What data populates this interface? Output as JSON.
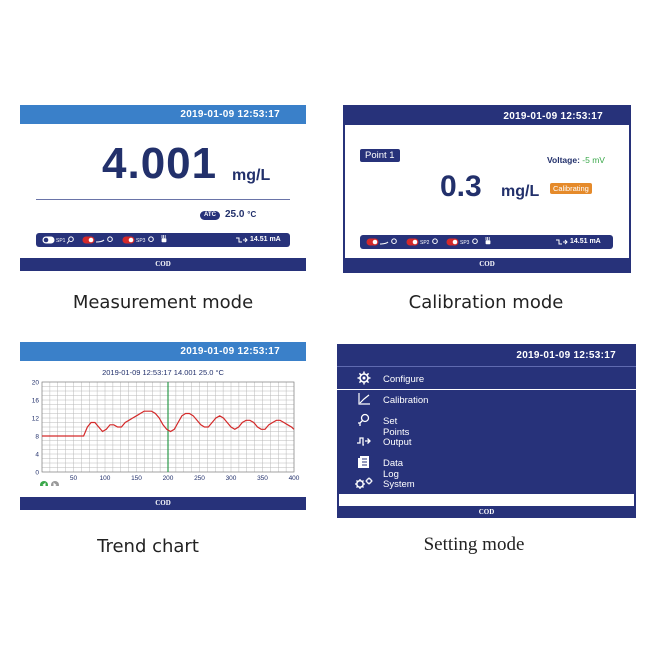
{
  "measurement": {
    "datetime": "2019-01-09   12:53:17",
    "value": "4.001",
    "unit": "mg/L",
    "atc_badge": "ATC",
    "temperature": "25.0",
    "temp_unit": "°C",
    "current": "14.51 mA",
    "relay_labels": [
      "SP1",
      "SP2",
      "SP3"
    ],
    "footer": "COD",
    "caption": "Measurement mode"
  },
  "calibration": {
    "datetime": "2019-01-09   12:53:17",
    "point_label": "Point 1",
    "voltage_label": "Voltage:",
    "voltage_value": "-5 mV",
    "value": "0.3",
    "unit": "mg/L",
    "status": "Calibrating",
    "current": "14.51 mA",
    "relay_labels": [
      "SP1",
      "SP2",
      "SP3"
    ],
    "footer": "COD",
    "caption": "Calibration mode"
  },
  "trend": {
    "datetime": "2019-01-09   12:53:17",
    "info": "2019-01-09  12:53:17 14.001 25.0 °C",
    "footer": "COD",
    "caption": "Trend chart"
  },
  "chart_data": {
    "type": "line",
    "title": "2019-01-09  12:53:17 14.001 25.0 °C",
    "xlabel": "",
    "ylabel": "",
    "xlim": [
      0,
      400
    ],
    "ylim": [
      0,
      20
    ],
    "x_ticks": [
      50,
      100,
      150,
      200,
      250,
      300,
      350,
      400
    ],
    "y_ticks": [
      0,
      4,
      8,
      12,
      16,
      20
    ],
    "grid": true,
    "cursor_x": 200,
    "series": [
      {
        "color": "#d42a2a",
        "x": [
          0,
          10,
          20,
          30,
          40,
          50,
          60,
          66,
          72,
          78,
          84,
          90,
          96,
          102,
          108,
          114,
          120,
          126,
          132,
          138,
          144,
          150,
          156,
          162,
          168,
          174,
          180,
          186,
          192,
          198,
          204,
          210,
          216,
          222,
          228,
          234,
          240,
          246,
          252,
          258,
          264,
          270,
          276,
          282,
          288,
          294,
          300,
          306,
          312,
          318,
          324,
          330,
          336,
          342,
          348,
          354,
          360,
          366,
          372,
          378,
          384,
          390,
          396,
          400
        ],
        "values": [
          8,
          8,
          8,
          8,
          8,
          8,
          8,
          8,
          10,
          11,
          11,
          10,
          9,
          9.5,
          10.5,
          10.5,
          10,
          10,
          11,
          11.5,
          12,
          12.5,
          13,
          13.5,
          13.5,
          13.5,
          13,
          12,
          10.5,
          9.5,
          9,
          9.5,
          11,
          12.5,
          13,
          13,
          12.5,
          11.5,
          10.5,
          10,
          10,
          11,
          12,
          12.5,
          12,
          11,
          10,
          9.5,
          10,
          11,
          11.5,
          11.5,
          11,
          10,
          9.5,
          9.5,
          10.5,
          11,
          11.5,
          11.5,
          11,
          10.5,
          10,
          9.5
        ]
      }
    ]
  },
  "settings": {
    "datetime": "2019-01-09   12:53:17",
    "menu": [
      {
        "label": "Configure",
        "icon": "gear-icon"
      },
      {
        "label": "Calibration",
        "icon": "calibration-curve-icon"
      },
      {
        "label": "Set Points",
        "icon": "set-points-icon"
      },
      {
        "label": "Output",
        "icon": "output-signal-icon"
      },
      {
        "label": "Data Log",
        "icon": "data-log-icon"
      },
      {
        "label": "System",
        "icon": "system-gears-icon"
      }
    ],
    "footer": "COD",
    "caption": "Setting mode"
  }
}
